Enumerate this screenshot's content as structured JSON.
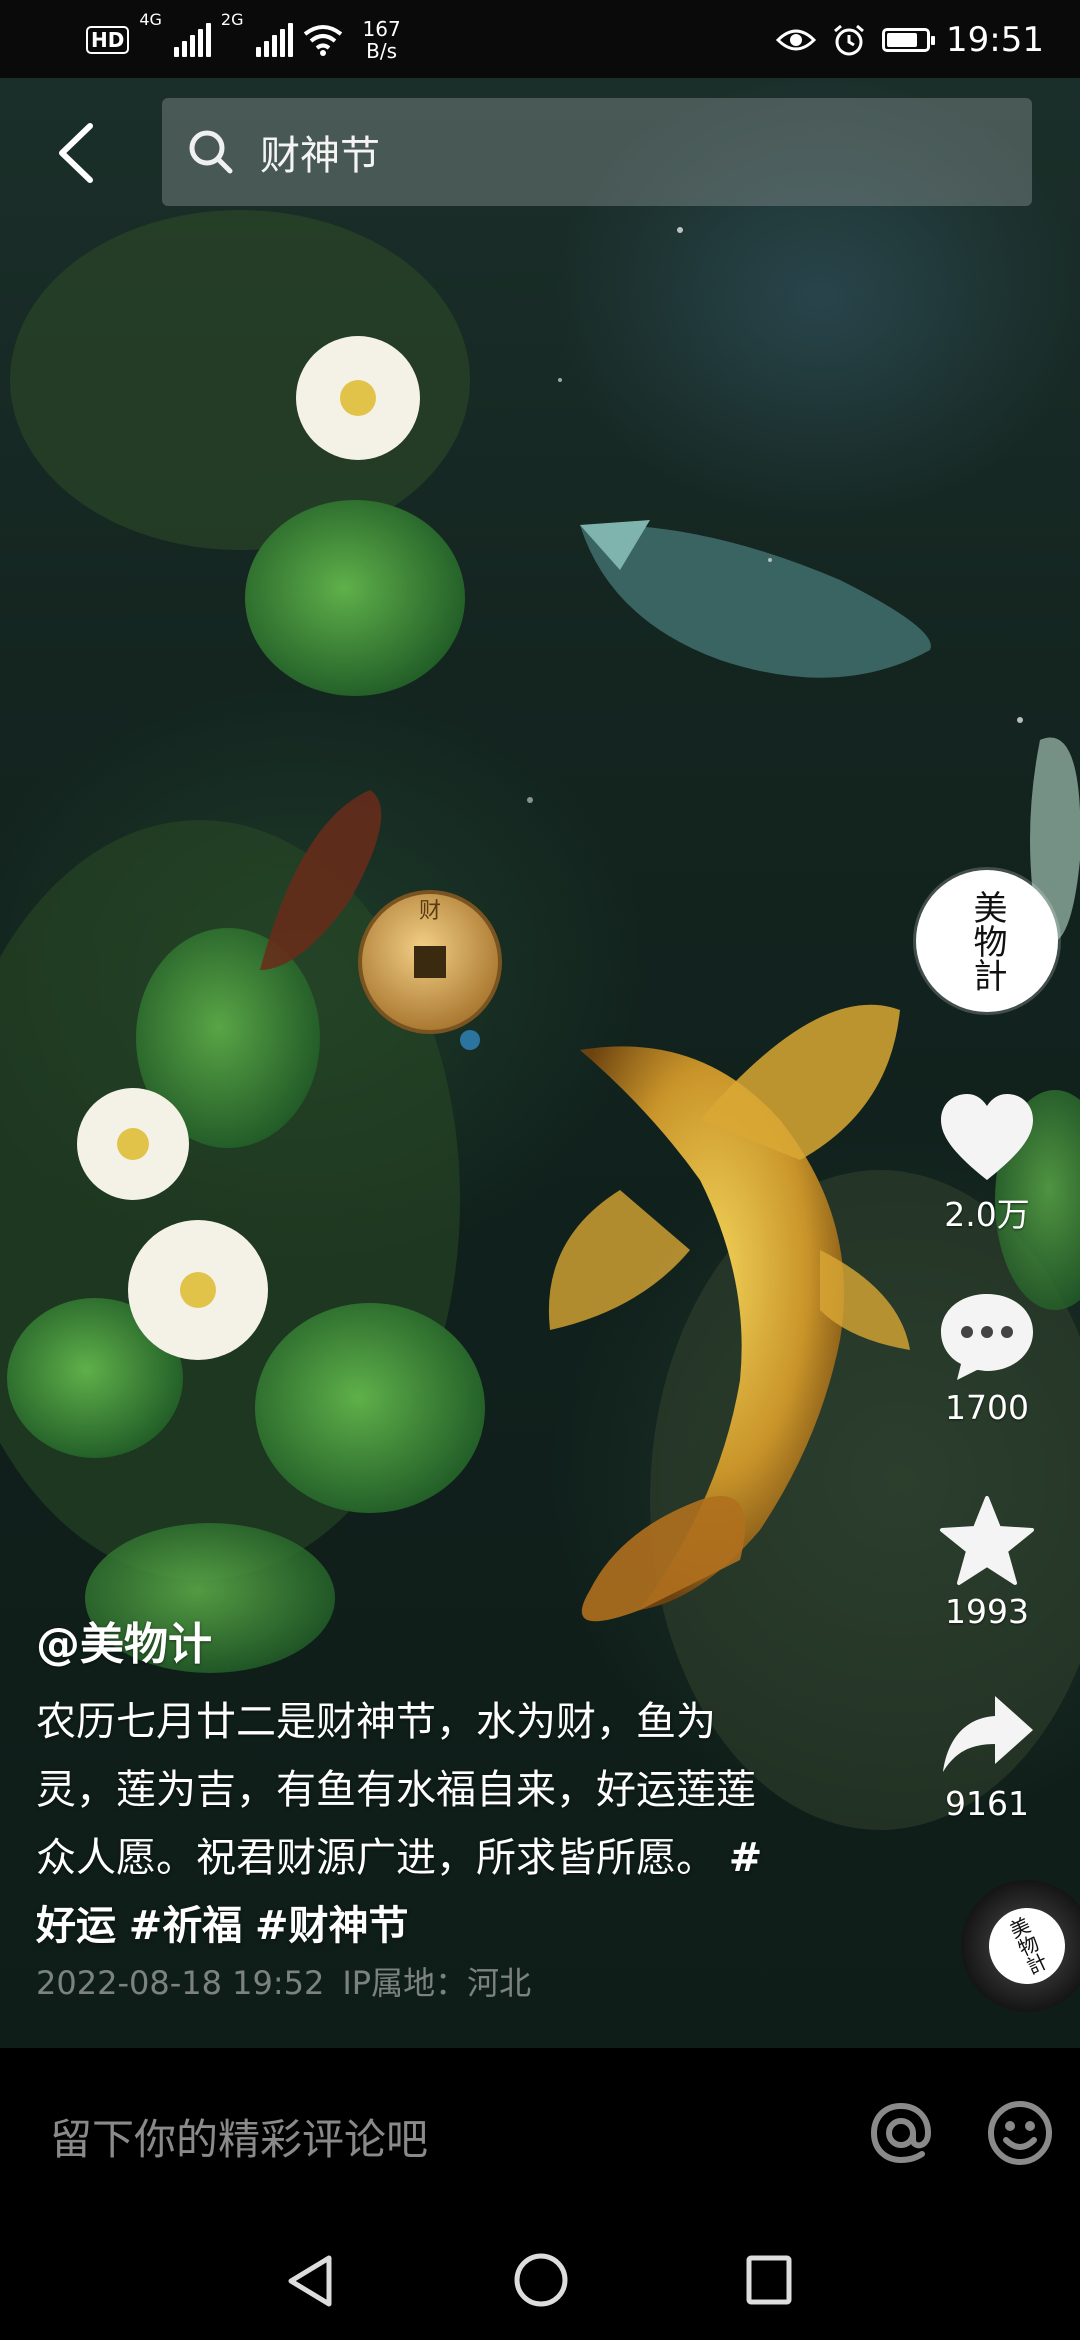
{
  "status_bar": {
    "hd": "HD",
    "sim1_label": "4G",
    "sim2_label": "2G",
    "net_speed_value": "167",
    "net_speed_unit": "B/s",
    "time": "19:51"
  },
  "search": {
    "query": "财神节"
  },
  "video": {
    "coin_text": "财"
  },
  "creator": {
    "avatar_text": "美物計",
    "handle": "@美物计"
  },
  "actions": {
    "likes": "2.0万",
    "comments": "1700",
    "favorites": "1993",
    "shares": "9161"
  },
  "caption": {
    "text": "农历七月廿二是财神节，水为财，鱼为灵，莲为吉，有鱼有水福自来，好运莲莲众人愿。祝君财源广进，所求皆所愿。",
    "tags": [
      "#好运",
      "#祈福",
      "#财神节"
    ]
  },
  "meta": {
    "date": "2022-08-18 19:52",
    "location": "IP属地：河北"
  },
  "music_disc": {
    "text": "美物計"
  },
  "comment_bar": {
    "placeholder": "留下你的精彩评论吧"
  },
  "icons": {
    "back": "back-arrow-icon",
    "search": "search-icon",
    "like": "heart-icon",
    "comment": "comment-bubble-icon",
    "favorite": "star-icon",
    "share": "share-arrow-icon",
    "mention": "at-icon",
    "emoji": "emoji-icon"
  }
}
